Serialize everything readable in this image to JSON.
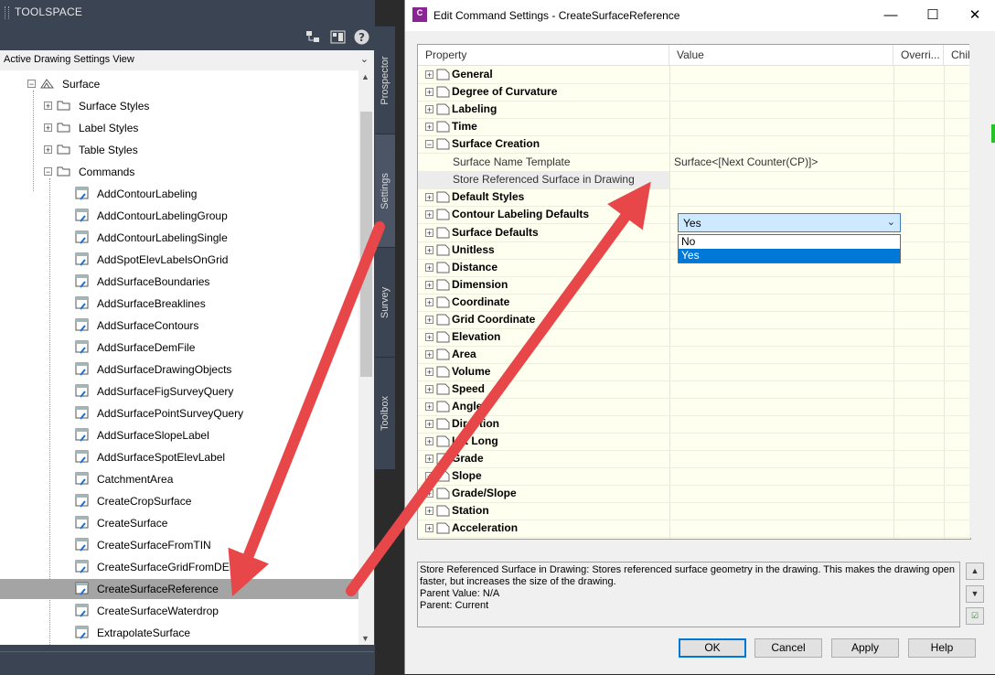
{
  "toolspace": {
    "title": "TOOLSPACE",
    "view_selector": "Active Drawing Settings View",
    "tree": [
      {
        "label": "Surface",
        "level": 0,
        "kind": "surface"
      },
      {
        "label": "Surface Styles",
        "level": 1,
        "kind": "folder"
      },
      {
        "label": "Label Styles",
        "level": 1,
        "kind": "folder"
      },
      {
        "label": "Table Styles",
        "level": 1,
        "kind": "folder"
      },
      {
        "label": "Commands",
        "level": 1,
        "kind": "folder-open"
      },
      {
        "label": "AddContourLabeling",
        "level": 2,
        "kind": "command"
      },
      {
        "label": "AddContourLabelingGroup",
        "level": 2,
        "kind": "command"
      },
      {
        "label": "AddContourLabelingSingle",
        "level": 2,
        "kind": "command"
      },
      {
        "label": "AddSpotElevLabelsOnGrid",
        "level": 2,
        "kind": "command"
      },
      {
        "label": "AddSurfaceBoundaries",
        "level": 2,
        "kind": "command"
      },
      {
        "label": "AddSurfaceBreaklines",
        "level": 2,
        "kind": "command"
      },
      {
        "label": "AddSurfaceContours",
        "level": 2,
        "kind": "command"
      },
      {
        "label": "AddSurfaceDemFile",
        "level": 2,
        "kind": "command"
      },
      {
        "label": "AddSurfaceDrawingObjects",
        "level": 2,
        "kind": "command"
      },
      {
        "label": "AddSurfaceFigSurveyQuery",
        "level": 2,
        "kind": "command"
      },
      {
        "label": "AddSurfacePointSurveyQuery",
        "level": 2,
        "kind": "command"
      },
      {
        "label": "AddSurfaceSlopeLabel",
        "level": 2,
        "kind": "command"
      },
      {
        "label": "AddSurfaceSpotElevLabel",
        "level": 2,
        "kind": "command"
      },
      {
        "label": "CatchmentArea",
        "level": 2,
        "kind": "command"
      },
      {
        "label": "CreateCropSurface",
        "level": 2,
        "kind": "command"
      },
      {
        "label": "CreateSurface",
        "level": 2,
        "kind": "command"
      },
      {
        "label": "CreateSurfaceFromTIN",
        "level": 2,
        "kind": "command"
      },
      {
        "label": "CreateSurfaceGridFromDEM",
        "level": 2,
        "kind": "command"
      },
      {
        "label": "CreateSurfaceReference",
        "level": 2,
        "kind": "command",
        "selected": true
      },
      {
        "label": "CreateSurfaceWaterdrop",
        "level": 2,
        "kind": "command"
      },
      {
        "label": "ExtrapolateSurface",
        "level": 2,
        "kind": "command"
      }
    ],
    "side_tabs": [
      "Prospector",
      "Settings",
      "Survey",
      "Toolbox"
    ],
    "active_side_tab": "Settings"
  },
  "dialog": {
    "title": "Edit Command Settings - CreateSurfaceReference",
    "app_icon_text": "C",
    "window_buttons": {
      "minimize": "—",
      "maximize": "☐",
      "close": "✕"
    },
    "columns": [
      "Property",
      "Value",
      "Overri...",
      "Chil"
    ],
    "properties": [
      {
        "label": "General",
        "expander": "+",
        "bold": true,
        "level": 0
      },
      {
        "label": "Degree of Curvature",
        "expander": "+",
        "bold": true,
        "level": 0
      },
      {
        "label": "Labeling",
        "expander": "+",
        "bold": true,
        "level": 0
      },
      {
        "label": "Time",
        "expander": "+",
        "bold": true,
        "level": 0
      },
      {
        "label": "Surface Creation",
        "expander": "−",
        "bold": true,
        "level": 0
      },
      {
        "label": "Surface Name Template",
        "value": "Surface<[Next Counter(CP)]>",
        "level": 1
      },
      {
        "label": "Store Referenced Surface in Drawing",
        "value": "Yes",
        "level": 1,
        "highlight": true
      },
      {
        "label": "Default Styles",
        "expander": "+",
        "bold": true,
        "level": 0
      },
      {
        "label": "Contour Labeling Defaults",
        "expander": "+",
        "bold": true,
        "level": 0
      },
      {
        "label": "Surface Defaults",
        "expander": "+",
        "bold": true,
        "level": 0
      },
      {
        "label": "Unitless",
        "expander": "+",
        "bold": true,
        "level": 0
      },
      {
        "label": "Distance",
        "expander": "+",
        "bold": true,
        "level": 0
      },
      {
        "label": "Dimension",
        "expander": "+",
        "bold": true,
        "level": 0
      },
      {
        "label": "Coordinate",
        "expander": "+",
        "bold": true,
        "level": 0
      },
      {
        "label": "Grid Coordinate",
        "expander": "+",
        "bold": true,
        "level": 0
      },
      {
        "label": "Elevation",
        "expander": "+",
        "bold": true,
        "level": 0
      },
      {
        "label": "Area",
        "expander": "+",
        "bold": true,
        "level": 0
      },
      {
        "label": "Volume",
        "expander": "+",
        "bold": true,
        "level": 0
      },
      {
        "label": "Speed",
        "expander": "+",
        "bold": true,
        "level": 0
      },
      {
        "label": "Angle",
        "expander": "+",
        "bold": true,
        "level": 0
      },
      {
        "label": "Direction",
        "expander": "+",
        "bold": true,
        "level": 0
      },
      {
        "label": "Lat Long",
        "expander": "+",
        "bold": true,
        "level": 0
      },
      {
        "label": "Grade",
        "expander": "+",
        "bold": true,
        "level": 0
      },
      {
        "label": "Slope",
        "expander": "+",
        "bold": true,
        "level": 0
      },
      {
        "label": "Grade/Slope",
        "expander": "+",
        "bold": true,
        "level": 0
      },
      {
        "label": "Station",
        "expander": "+",
        "bold": true,
        "level": 0
      },
      {
        "label": "Acceleration",
        "expander": "+",
        "bold": true,
        "level": 0
      }
    ],
    "dropdown": {
      "current": "Yes",
      "options": [
        "No",
        "Yes"
      ],
      "selected": "Yes"
    },
    "description": [
      "Store Referenced Surface in Drawing: Stores referenced surface geometry in the drawing. This makes the drawing open",
      "faster, but increases the size of the drawing.",
      "Parent Value: N/A",
      "Parent: Current"
    ],
    "buttons": {
      "ok": "OK",
      "cancel": "Cancel",
      "apply": "Apply",
      "help": "Help"
    }
  },
  "colors": {
    "toolspace_bg": "#3b4453",
    "selection": "#a4a4a4",
    "grid_bg": "#fffff0",
    "dropdown_highlight": "#0078d7",
    "arrow": "#e8474a"
  }
}
